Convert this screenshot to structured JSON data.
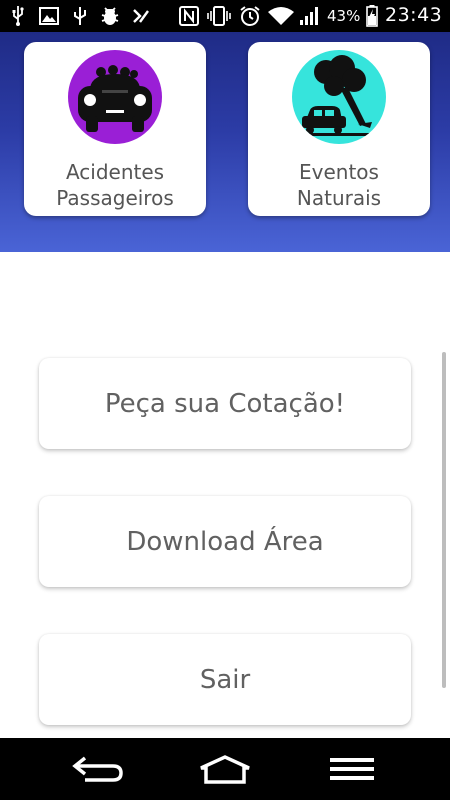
{
  "status_bar": {
    "battery_percent": "43%",
    "time": "23:43",
    "icons": [
      "usb-icon",
      "image-icon",
      "usb-debug-icon",
      "bug-icon",
      "check-icon",
      "nfc-icon",
      "vibrate-icon",
      "alarm-icon",
      "wifi-icon",
      "signal-icon",
      "battery-charging-icon"
    ]
  },
  "categories": [
    {
      "label": "Acidentes\nPassageiros",
      "icon": "car-passengers-icon",
      "color": "#9a1fd6"
    },
    {
      "label": "Eventos\nNaturais",
      "icon": "tree-falling-on-car-icon",
      "color": "#36e4dc"
    }
  ],
  "buttons": {
    "cotacao": "Peça sua Cotação!",
    "download": "Download Área",
    "sair": "Sair"
  },
  "nav_bar": {
    "icons": [
      "back-icon",
      "home-icon",
      "menu-icon"
    ]
  },
  "colors": {
    "header_gradient_top": "#1f2b86",
    "header_gradient_bottom": "#4a64d6",
    "button_text": "#616161"
  }
}
